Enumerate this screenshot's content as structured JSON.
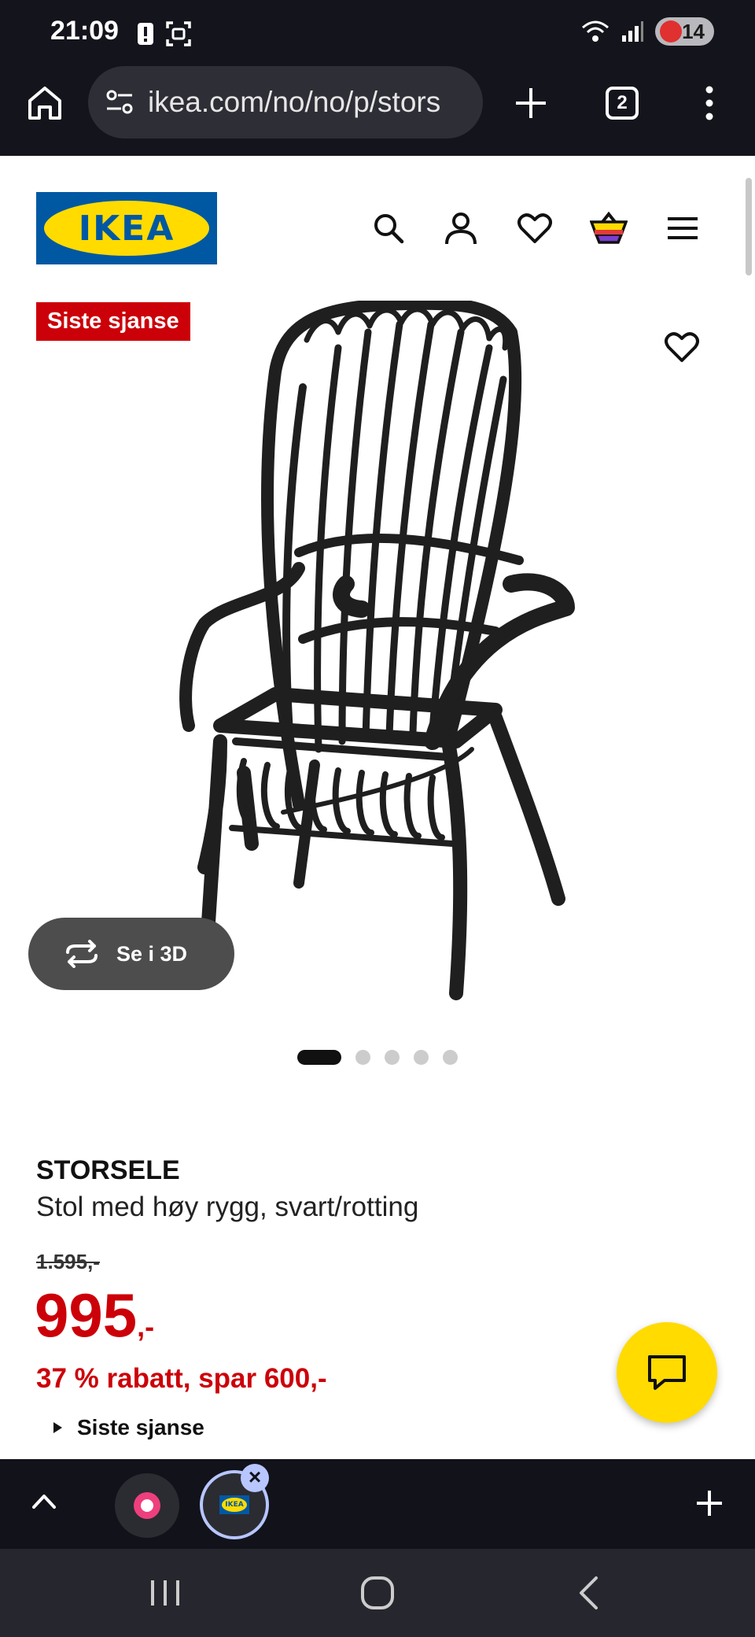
{
  "status_bar": {
    "time": "21:09",
    "battery": "14"
  },
  "browser": {
    "url": "ikea.com/no/no/p/stors",
    "tabs_count": "2"
  },
  "header": {
    "logo_text": "IKEA"
  },
  "product": {
    "badge": "Siste sjanse",
    "view_3d_label": "Se i 3D",
    "gallery_count": 5,
    "gallery_active": 1,
    "name": "STORSELE",
    "description": "Stol med høy rygg, svart/rotting",
    "old_price": "1.595,-",
    "price": "995",
    "price_suffix": ",-",
    "discount": "37 % rabatt, spar 600,-",
    "last_chance_label": "Siste sjanse"
  },
  "colors": {
    "ikea_blue": "#0058a3",
    "ikea_yellow": "#ffdb00",
    "sale_red": "#cc0008"
  },
  "tab_switcher": {
    "tab2_logo": "IKEA"
  }
}
